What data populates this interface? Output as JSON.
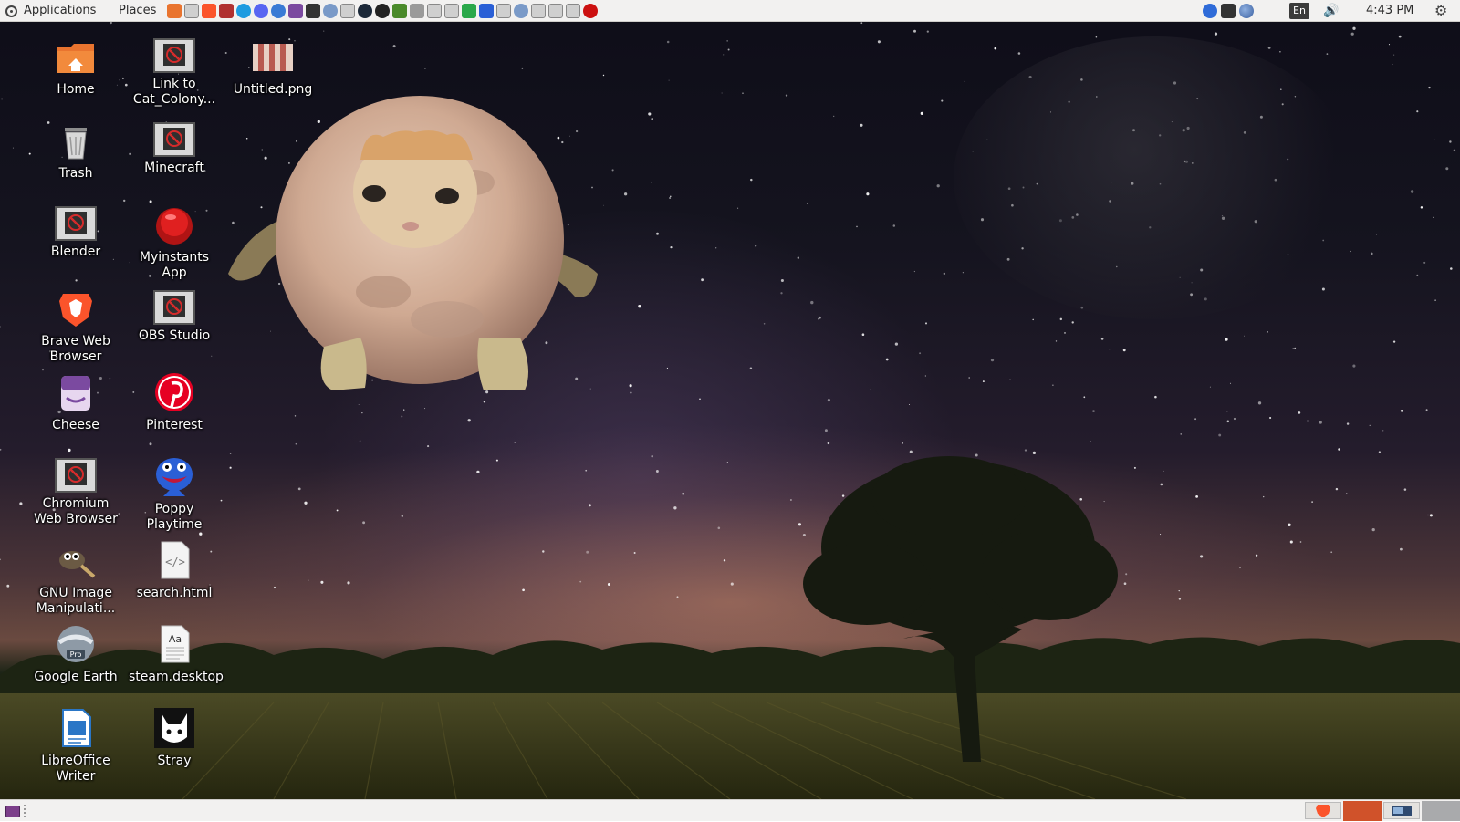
{
  "top_panel": {
    "applications_label": "Applications",
    "places_label": "Places",
    "launchers": [
      "files-icon",
      "generic-app-icon",
      "brave-icon",
      "app-icon",
      "skype-icon",
      "discord-icon",
      "chromium-icon",
      "bookmark-icon",
      "cat-face-icon",
      "globe-icon",
      "generic-app-icon",
      "steam-icon",
      "circle-app-icon",
      "minecraft-icon",
      "hat-icon",
      "generic-app-icon",
      "generic-app-icon",
      "green-app-icon",
      "flag-icon",
      "generic-app-icon",
      "globe-icon",
      "generic-app-icon",
      "generic-app-icon",
      "generic-app-icon",
      "red-record-icon"
    ],
    "tray": {
      "keyboard_layout": "En",
      "volume_glyph": "🔊",
      "clock": "4:43 PM",
      "settings_glyph": "⚙"
    }
  },
  "desktop": {
    "icons": [
      {
        "label": "Home",
        "icon": "home-folder-icon"
      },
      {
        "label": "Trash",
        "icon": "trash-icon"
      },
      {
        "label": "Blender",
        "icon": "broken-launcher-icon"
      },
      {
        "label": "Brave Web Browser",
        "icon": "brave-lion-icon"
      },
      {
        "label": "Cheese",
        "icon": "cheese-icon"
      },
      {
        "label": "Chromium Web Browser",
        "icon": "broken-launcher-icon"
      },
      {
        "label": "GNU Image Manipulati...",
        "icon": "gimp-icon"
      },
      {
        "label": "Google Earth",
        "icon": "google-earth-icon"
      },
      {
        "label": "LibreOffice Writer",
        "icon": "writer-document-icon"
      },
      {
        "label": "Link to Cat_Colony...",
        "icon": "broken-launcher-icon"
      },
      {
        "label": "Minecraft",
        "icon": "broken-launcher-icon"
      },
      {
        "label": "Myinstants App",
        "icon": "red-button-icon"
      },
      {
        "label": "OBS Studio",
        "icon": "broken-launcher-icon"
      },
      {
        "label": "Pinterest",
        "icon": "pinterest-icon"
      },
      {
        "label": "Poppy Playtime",
        "icon": "huggy-wuggy-icon"
      },
      {
        "label": "search.html",
        "icon": "html-file-icon"
      },
      {
        "label": "steam.desktop",
        "icon": "font-file-icon"
      },
      {
        "label": "Stray",
        "icon": "stray-cat-icon"
      },
      {
        "label": "Untitled.png",
        "icon": "image-thumbnail-icon"
      }
    ]
  },
  "wallpaper": {
    "subject": "moon-with-cat-face",
    "colors": {
      "sky_top": "#0e0d18",
      "horizon": "#6a4a40",
      "moon": "#d8b8a4",
      "field": "#3a3a1c"
    }
  },
  "bottom_panel": {
    "workspaces": [
      "brave-window-icon",
      "active-workspace",
      "window-thumbnail-icon",
      "empty-workspace"
    ]
  }
}
